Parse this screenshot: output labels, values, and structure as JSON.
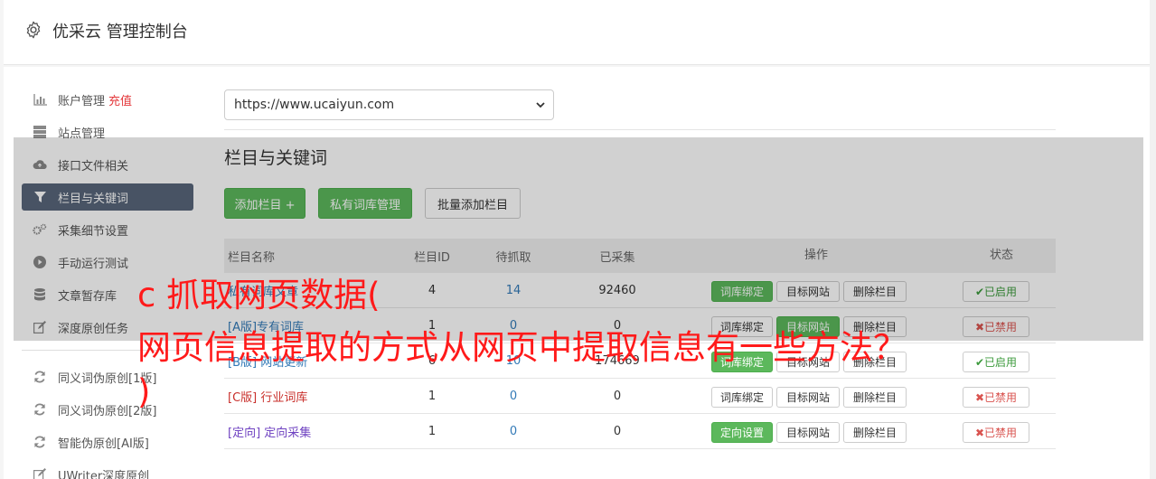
{
  "header": {
    "title": "优采云 管理控制台",
    "icon": "gear-icon"
  },
  "sidebar": {
    "items": [
      {
        "label": "账户管理",
        "extra": "充值",
        "icon": "bar-chart-icon"
      },
      {
        "label": "站点管理",
        "icon": "server-icon"
      },
      {
        "label": "接口文件相关",
        "icon": "cloud-upload-icon"
      },
      {
        "label": "栏目与关键词",
        "icon": "filter-icon",
        "active": true
      },
      {
        "label": "采集细节设置",
        "icon": "gears-icon"
      },
      {
        "label": "手动运行测试",
        "icon": "play-circle-icon"
      },
      {
        "label": "文章暂存库",
        "icon": "database-icon"
      },
      {
        "label": "深度原创任务",
        "icon": "edit-icon"
      }
    ],
    "items2": [
      {
        "label": "同义词伪原创[1版]",
        "icon": "refresh-icon"
      },
      {
        "label": "同义词伪原创[2版]",
        "icon": "refresh-icon"
      },
      {
        "label": "智能伪原创[AI版]",
        "icon": "refresh-icon"
      },
      {
        "label": "UWriter深度原创",
        "icon": "edit-icon"
      }
    ]
  },
  "site_select": {
    "value": "https://www.ucaiyun.com"
  },
  "section": {
    "title": "栏目与关键词",
    "add_column": "添加栏目 +",
    "private_lib": "私有词库管理",
    "batch_add": "批量添加栏目"
  },
  "table": {
    "headers": {
      "name": "栏目名称",
      "id": "栏目ID",
      "pending": "待抓取",
      "collected": "已采集",
      "ops": "操作",
      "status": "状态"
    },
    "rows": [
      {
        "tag": "",
        "name": "私有词库文章",
        "id": "4",
        "pending": "14",
        "collected": "92460",
        "op1": "词库绑定",
        "op2": "目标网站",
        "op3": "删除栏目",
        "status": "已启用"
      },
      {
        "tag": "[A版]",
        "name": "专有词库",
        "id": "1",
        "pending": "0",
        "collected": "0",
        "op1": "词库绑定",
        "op2": "目标网站",
        "op3": "删除栏目",
        "status": "已禁用"
      },
      {
        "tag": "[B版]",
        "name": "网站更新",
        "id": "6",
        "pending": "10",
        "collected": "174669",
        "op1": "词库绑定",
        "op2": "目标网站",
        "op3": "删除栏目",
        "status": "已启用"
      },
      {
        "tag": "[C版]",
        "name": "行业词库",
        "id": "1",
        "pending": "0",
        "collected": "0",
        "op1": "词库绑定",
        "op2": "目标网站",
        "op3": "删除栏目",
        "status": "已禁用"
      },
      {
        "tag": "[定向]",
        "name": "定向采集",
        "id": "1",
        "pending": "0",
        "collected": "0",
        "op1": "定向设置",
        "op2": "目标网站",
        "op3": "删除栏目",
        "status": "已禁用"
      }
    ]
  },
  "overlay_text": {
    "line1": "c 抓取网页数据(",
    "line2": "网页信息提取的方式从网页中提取信息有一些方法？",
    "line3": ")"
  },
  "colors": {
    "accent_green": "#5cb85c",
    "active_nav": "#58667a",
    "overlay_red": "#ff1a1a",
    "link_blue": "#337ab7"
  }
}
